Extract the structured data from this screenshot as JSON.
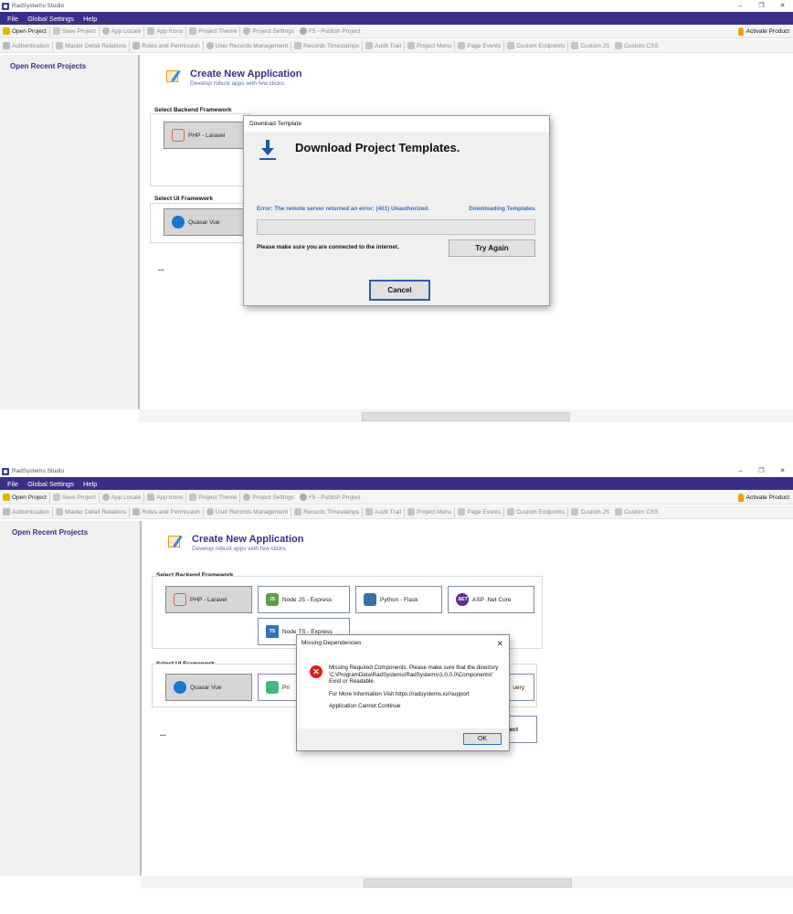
{
  "window": {
    "title": "RadSystems Studio",
    "controls": [
      "–",
      "❐",
      "✕"
    ]
  },
  "menu": [
    "File",
    "Global Settings",
    "Help"
  ],
  "toolbar1": {
    "items": [
      "Open Project",
      "Save Project",
      "App Locale",
      "App Icons",
      "Project Theme",
      "Project Settings",
      "F5 - Publish Project"
    ],
    "activate": "Activate Product"
  },
  "toolbar2": {
    "items": [
      "Authentication",
      "Master Detail Relations",
      "Roles and Permission",
      "User Records Management",
      "Records Timestamps",
      "Audit Trail",
      "Project Menu",
      "Page Events",
      "Custom Endpoints",
      "Custom JS",
      "Custom CSS"
    ]
  },
  "sidebar": {
    "title": "Open Recent Projects"
  },
  "create": {
    "title": "Create New Application",
    "subtitle": "Develop robust apps with few clicks."
  },
  "backend": {
    "label": "Select Backend Framework"
  },
  "ui": {
    "label": "Select UI Framework"
  },
  "ellipsis": "...",
  "frameworks": {
    "laravel": "PHP - Laravel",
    "node": "Node JS - Express",
    "python": "Python - Flask",
    "aspnet": "ASP .Net Core",
    "nodets": "Node TS - Express",
    "quasar": "Quasar Vue",
    "prime": "Pri",
    "jquery": "uery",
    "bootstrap_partial": "ect"
  },
  "logos": {
    "node": "JS",
    "aspnet": ".NET",
    "nodets": "TS"
  },
  "download_dialog": {
    "title": "Download Template",
    "heading": "Download Project Templates.",
    "error": "Error: The remote server returned an error: (401) Unauthorized.",
    "status": "Downloading Templates.",
    "note": "Please make sure you are connected to the internet.",
    "retry": "Try Again",
    "cancel": "Cancel"
  },
  "missing_dialog": {
    "title": "Missing Dependencies",
    "close": "✕",
    "icon": "✕",
    "line1": "Missing Required Components. Please make sure that the directory",
    "line2": "'C:\\ProgramData\\RadSystems\\RadSystems\\1.0.0.0\\Components\\' Exist or Readable.",
    "line3": "For More Information Visit https://radsystems.io//support",
    "line4": "Application Cannot Continue",
    "ok": "OK"
  },
  "colors": {
    "accent": "#3a2f85",
    "link": "#2d6fc9",
    "error": "#e01e1e"
  }
}
